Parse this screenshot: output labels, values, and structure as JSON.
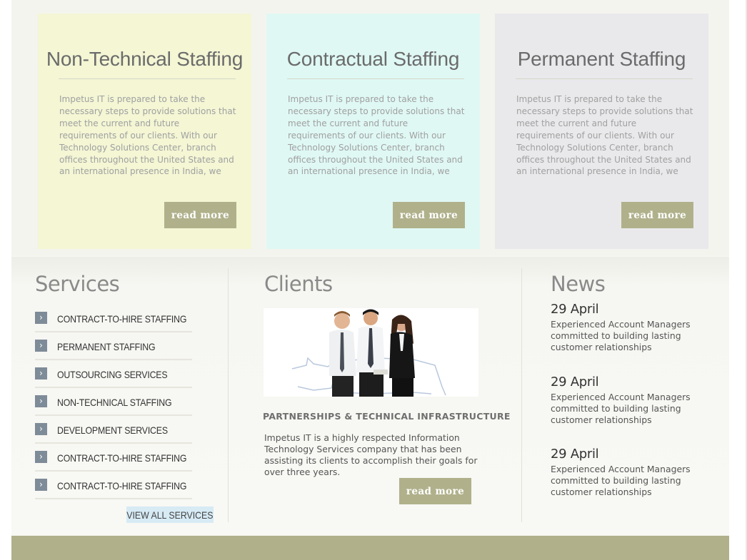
{
  "colors": {
    "card1_bg": "#f4f6d4",
    "card2_bg": "#dff8f4",
    "card3_bg": "#e9e9ec",
    "button_bg": "#b0b18b",
    "view_all_bg": "#d7ebf5",
    "service_arrow_bg": "#7e8b98",
    "footer_bg": "#b0b18b"
  },
  "cards": [
    {
      "title": "Non-Technical Staffing",
      "body": "Impetus IT  is prepared to take the necessary steps to provide solutions that meet the current and future requirements of our clients. With our Technology Solutions Center, branch offices throughout the United States and an international presence in India, we have demonstrated",
      "button": "read more"
    },
    {
      "title": "Contractual Staffing",
      "body": "Impetus IT  is prepared to take the necessary steps to provide solutions that meet the current and future requirements of our clients. With our Technology Solutions Center, branch offices throughout the United States and an international presence in India, we have demonstrated",
      "button": "read more"
    },
    {
      "title": "Permanent Staffing",
      "body": "Impetus IT  is prepared to take the necessary steps to provide solutions that meet the current and future requirements of our clients. With our Technology Solutions Center, branch offices throughout the United States and an international presence in India, we have demonstrated",
      "button": "read more"
    }
  ],
  "services": {
    "title": "Services",
    "items": [
      "CONTRACT-TO-HIRE STAFFING",
      "PERMANENT STAFFING",
      "OUTSOURCING SERVICES",
      "NON-TECHNICAL STAFFING",
      "DEVELOPMENT SERVICES",
      "CONTRACT-TO-HIRE STAFFING",
      "CONTRACT-TO-HIRE STAFFING"
    ],
    "arrow_icon": "chevron-right-icon",
    "view_all": "VIEW ALL SERVICES"
  },
  "clients": {
    "title": "Clients",
    "image": "business-people-photo",
    "heading": "PARTNERSHIPS & TECHNICAL INFRASTRUCTURE",
    "text": "Impetus IT is a highly respected Information Technology Services company that has been assisting its clients to accomplish their goals for over three years.",
    "button": "read more"
  },
  "news": {
    "title": "News",
    "items": [
      {
        "date": "29 April",
        "text": "Experienced Account Managers committed to building lasting customer relationships"
      },
      {
        "date": "29 April",
        "text": "Experienced Account Managers committed to building lasting customer relationships"
      },
      {
        "date": "29 April",
        "text": "Experienced Account Managers committed to building lasting customer relationships"
      }
    ]
  }
}
